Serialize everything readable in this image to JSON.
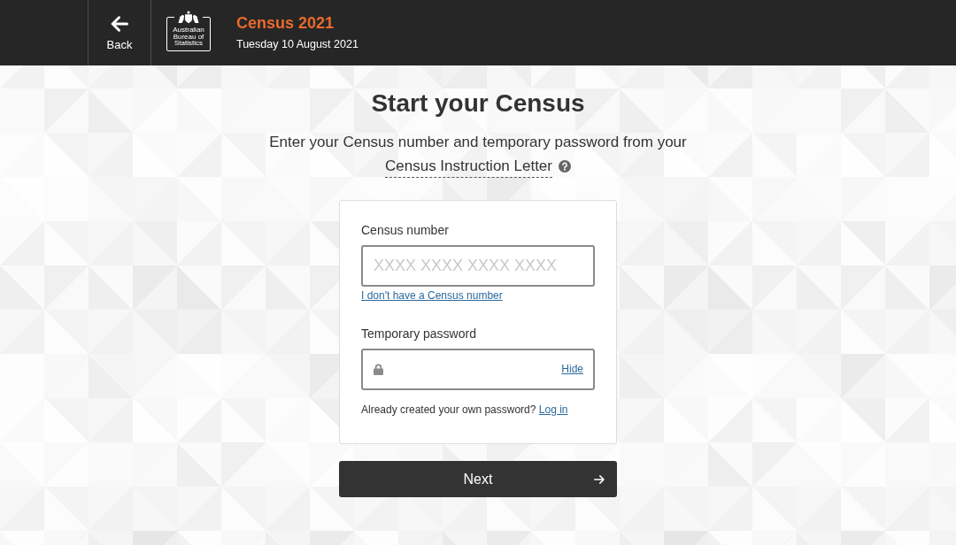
{
  "header": {
    "back": {
      "label": "Back"
    },
    "logo": {
      "lines": [
        "Australian",
        "Bureau of",
        "Statistics"
      ]
    },
    "title": "Census 2021",
    "date": "Tuesday 10 August 2021"
  },
  "page": {
    "heading": "Start your Census",
    "intro": "Enter your Census number and temporary password from your",
    "intro_link": "Census Instruction Letter"
  },
  "form": {
    "fields": [
      {
        "kind": "text",
        "label": "Census number",
        "placeholder": "XXXX XXXX XXXX XXXX",
        "link": "I don't have a Census number"
      },
      {
        "kind": "password",
        "label": "Temporary password",
        "toggle": "Hide"
      }
    ],
    "login_prompt": "Already created your own password?",
    "login_link": "Log in"
  },
  "next_button": {
    "label": "Next"
  }
}
